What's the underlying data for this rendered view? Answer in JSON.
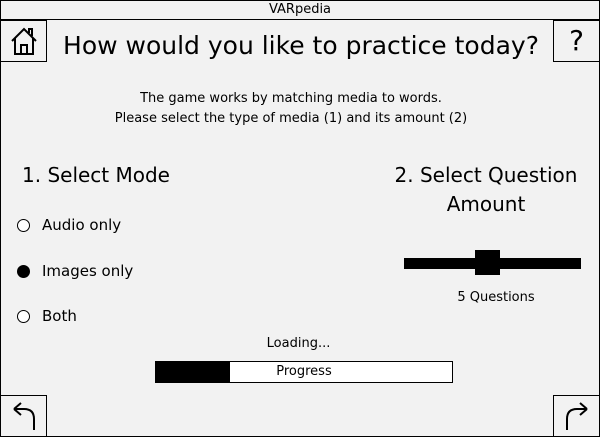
{
  "window": {
    "title": "VARpedia"
  },
  "header": {
    "title": "How would you like to practice today?",
    "home_icon": "home-icon",
    "help_label": "?"
  },
  "instructions": {
    "line1": "The game works by matching media to words.",
    "line2": "Please select the type of media (1) and its amount (2)"
  },
  "mode": {
    "title": "1. Select Mode",
    "options": [
      {
        "label": "Audio only",
        "checked": false
      },
      {
        "label": "Images only",
        "checked": true
      },
      {
        "label": "Both",
        "checked": false
      }
    ]
  },
  "amount": {
    "title_line1": "2. Select Question",
    "title_line2": "Amount",
    "value_label": "5 Questions",
    "slider_fraction": 0.47
  },
  "loading": {
    "label": "Loading...",
    "progress_label": "Progress",
    "progress_fraction": 0.25
  },
  "nav": {
    "back_icon": "back-arrow-icon",
    "next_icon": "forward-arrow-icon"
  },
  "colors": {
    "background": "#f2f2f2",
    "foreground": "#000000"
  }
}
